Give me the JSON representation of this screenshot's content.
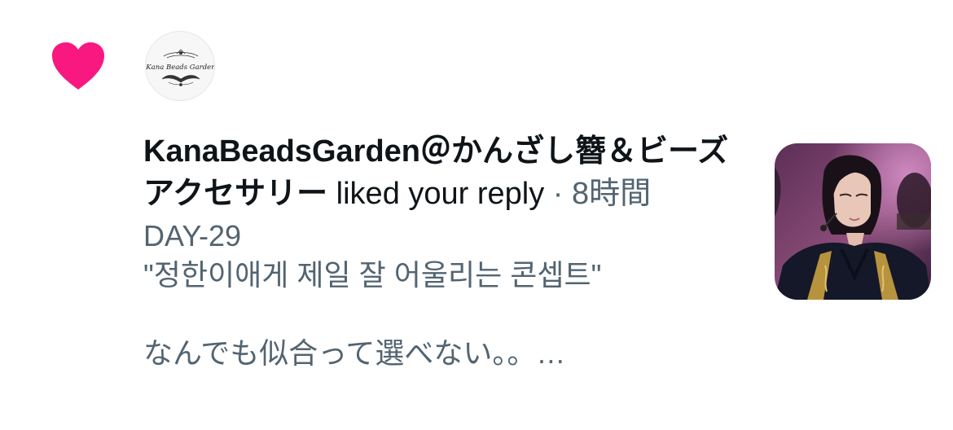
{
  "colors": {
    "heart": "#f91880",
    "primary_text": "#0f1419",
    "secondary_text": "#536471"
  },
  "icons": {
    "heart": "heart-icon"
  },
  "notification": {
    "avatar_logo_text": "Kana Beads Garden",
    "user_name": "KanaBeadsGarden＠かんざし簪＆ビーズアクセサリー",
    "action": "liked your reply",
    "separator": "·",
    "time": "8時間",
    "tweet_lines": [
      "DAY-29",
      "\"정한이애게 제일 잘 어울리는 콘셉트\"",
      "",
      "なんでも似合って選べない。。…"
    ]
  }
}
